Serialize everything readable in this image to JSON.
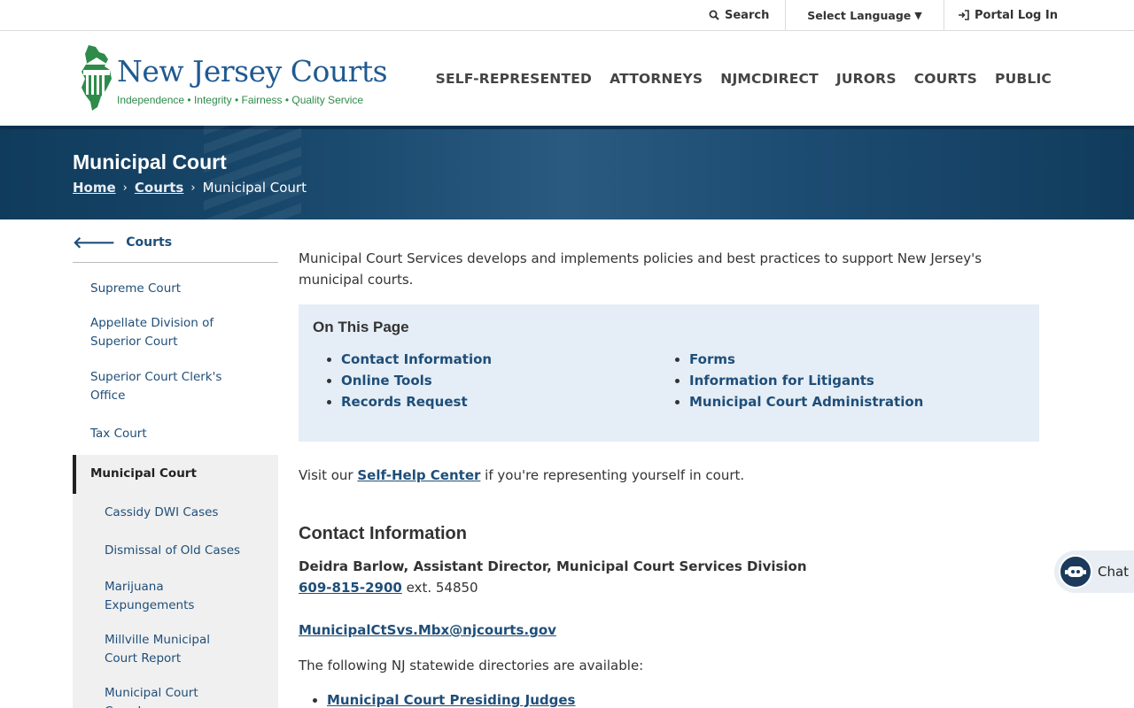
{
  "utility": {
    "search_label": "Search",
    "language_label": "Select Language",
    "portal_label": "Portal Log In"
  },
  "header": {
    "logo_title": "New Jersey Courts",
    "logo_tagline": "Independence • Integrity • Fairness • Quality Service",
    "nav": [
      "SELF-REPRESENTED",
      "ATTORNEYS",
      "NJMCDIRECT",
      "JURORS",
      "COURTS",
      "PUBLIC"
    ]
  },
  "banner": {
    "title": "Municipal Court",
    "breadcrumbs": [
      "Home",
      "Courts",
      "Municipal Court"
    ]
  },
  "sidebar": {
    "back_label": "Courts",
    "items": [
      "Supreme Court",
      "Appellate Division of Superior Court",
      "Superior Court Clerk's Office",
      "Tax Court"
    ],
    "active": "Municipal Court",
    "subitems": [
      "Cassidy DWI Cases",
      "Dismissal of Old Cases",
      "Marijuana Expungements",
      "Millville Municipal Court Report",
      "Municipal Court Case Law"
    ]
  },
  "main": {
    "intro": "Municipal Court Services develops and implements policies and best practices to support New Jersey's municipal courts.",
    "on_this_page": {
      "heading": "On This Page",
      "col1": [
        "Contact Information",
        "Online Tools",
        "Records Request"
      ],
      "col2": [
        "Forms",
        "Information for Litigants",
        "Municipal Court Administration"
      ]
    },
    "selfhelp_prefix": "Visit our ",
    "selfhelp_link": "Self-Help Center",
    "selfhelp_suffix": " if you're representing yourself in court.",
    "contact_heading": "Contact Information",
    "contact_name": "Deidra Barlow, Assistant Director, Municipal Court Services Division",
    "contact_phone": "609-815-2900",
    "contact_ext": " ext. 54850",
    "contact_email": "MunicipalCtSvs.Mbx@njcourts.gov",
    "directories_text": "The following NJ statewide directories are available:",
    "directories": [
      "Municipal Court Presiding Judges"
    ]
  },
  "chat": {
    "label": "Chat"
  },
  "colors": {
    "accent_blue": "#1f4e79",
    "banner": "#103b5c",
    "logo_green": "#2e8b4a",
    "panel": "#e5eef6"
  }
}
